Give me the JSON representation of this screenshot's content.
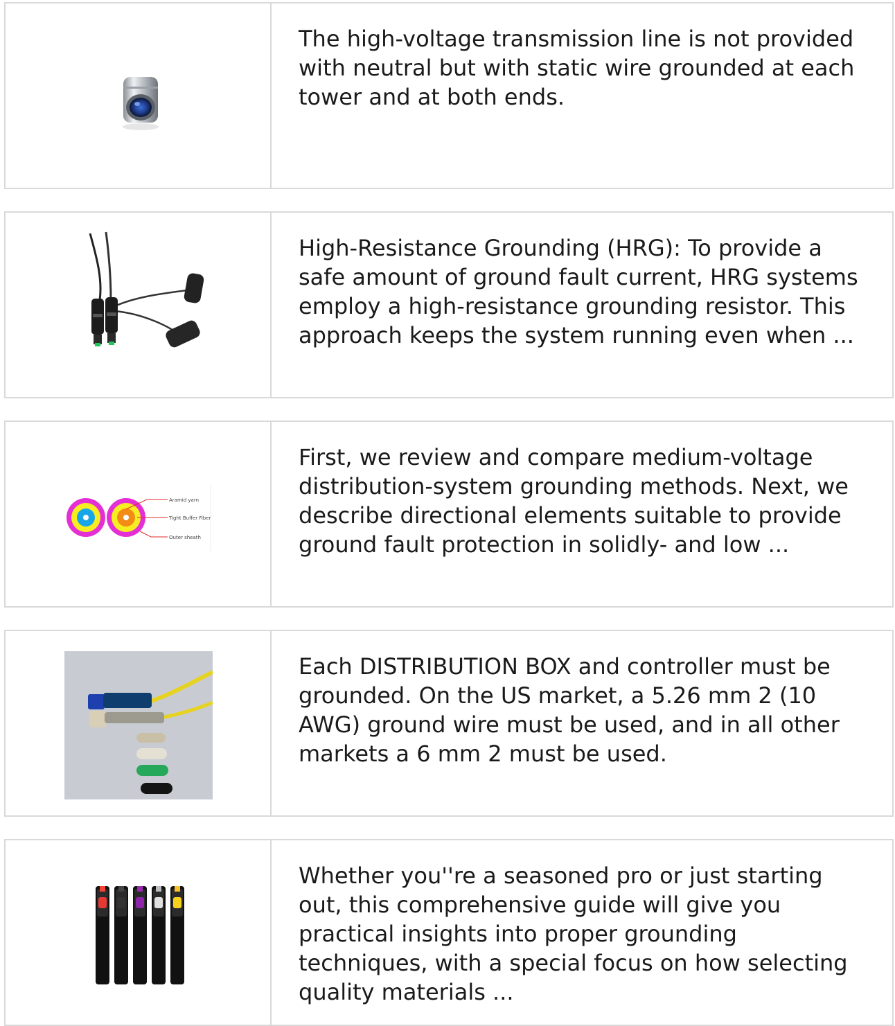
{
  "articles": [
    {
      "image": "fiber-adapter-barrel-image",
      "text": "The high-voltage transmission line is not provided with neutral but with static wire grounded at each tower and at both ends."
    },
    {
      "image": "waterproof-fiber-connector-cable-image",
      "text": "High-Resistance Grounding (HRG): To provide a safe amount of ground fault current, HRG systems employ a high-resistance grounding resistor. This approach keeps the system running even when ..."
    },
    {
      "image": "tight-buffer-fiber-cross-section-image",
      "diagram_labels": [
        "Aramid yarn",
        "Tight Buffer Fiber",
        "Outer sheath"
      ],
      "text": "First, we review and compare medium-voltage distribution-system grounding methods. Next, we describe directional elements suitable to provide ground fault protection in solidly- and low ..."
    },
    {
      "image": "sc-connector-parts-photo",
      "text": "Each DISTRIBUTION BOX and controller must be grounded. On the US market, a 5.26 mm 2 (10 AWG) ground wire must be used, and in all other markets a 6 mm 2 must be used."
    },
    {
      "image": "visual-fault-locator-pens-image",
      "text": "Whether you''re a seasoned pro or just starting out, this comprehensive guide will give you practical insights into proper grounding techniques, with a special focus on how selecting quality materials ..."
    }
  ]
}
